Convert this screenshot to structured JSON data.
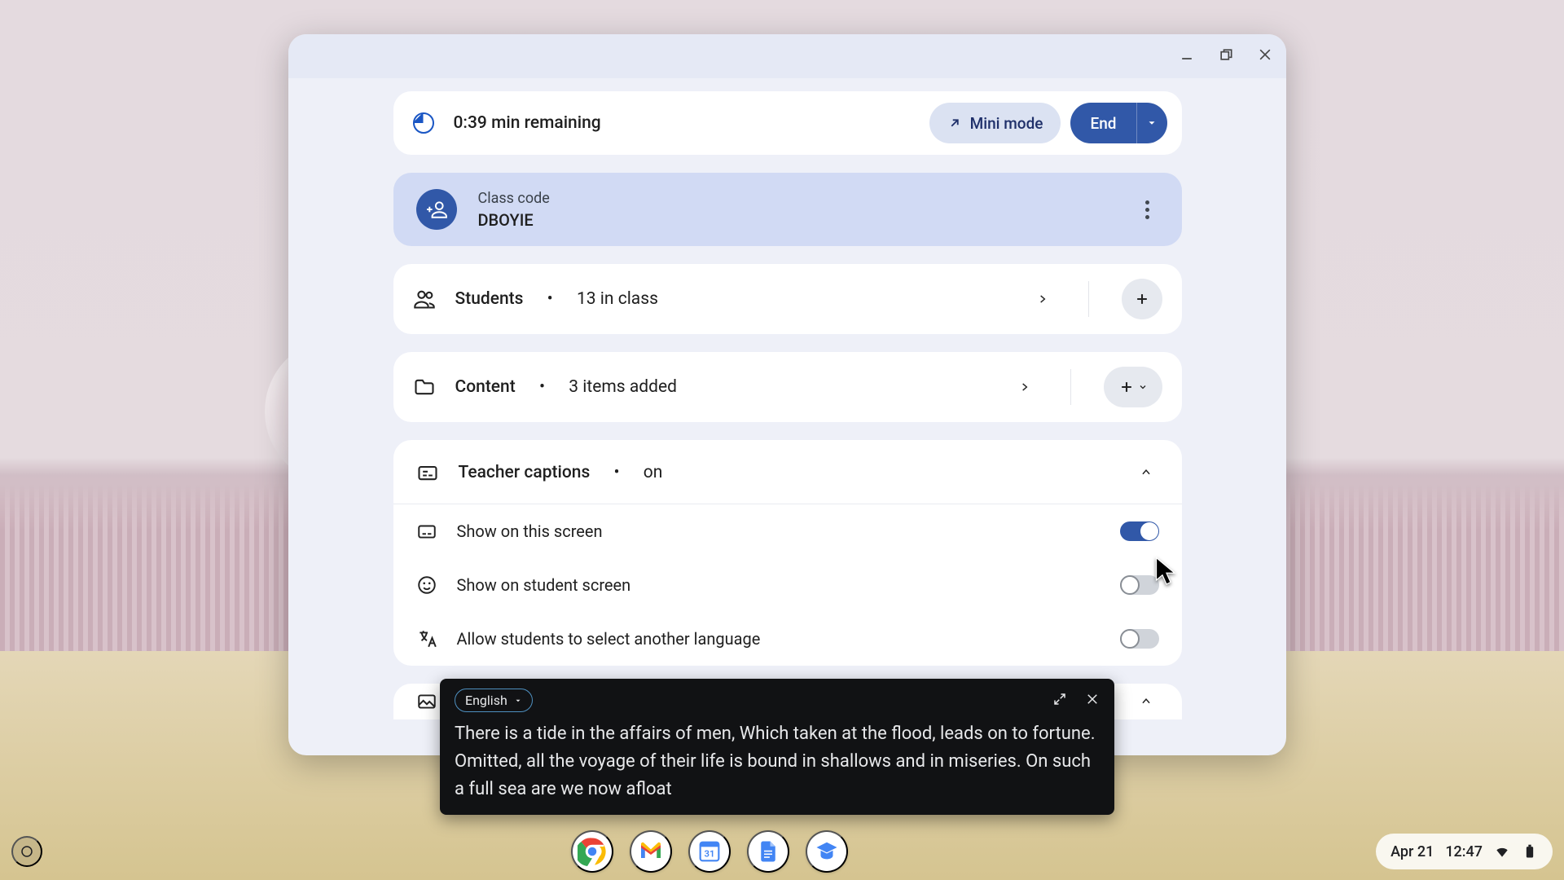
{
  "toolbar": {
    "time_remaining": "0:39 min remaining",
    "mini_mode": "Mini mode",
    "end": "End"
  },
  "class_code": {
    "label": "Class code",
    "value": "DBOYIE"
  },
  "students": {
    "title": "Students",
    "subtitle": "13 in class"
  },
  "content": {
    "title": "Content",
    "subtitle": "3 items added"
  },
  "captions_section": {
    "title": "Teacher captions",
    "state": "on",
    "rows": {
      "show_this": "Show on this screen",
      "show_student": "Show on student screen",
      "allow_lang": "Allow students to select another language"
    }
  },
  "caption_overlay": {
    "language": "English",
    "text": "There is a tide in the affairs of men, Which taken at the flood, leads on to fortune. Omitted, all the voyage of their life is bound in shallows and in miseries. On such a full sea are we now afloat"
  },
  "shelf": {
    "date": "Apr 21",
    "time": "12:47",
    "calendar_day": "31"
  }
}
